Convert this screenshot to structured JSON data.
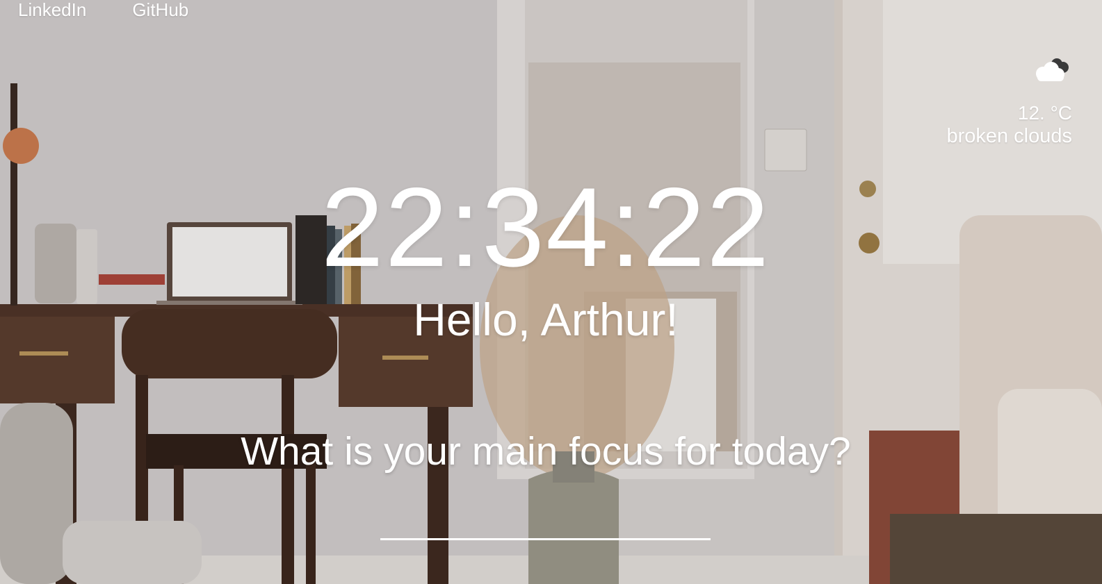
{
  "nav": {
    "links": [
      {
        "label": "LinkedIn"
      },
      {
        "label": "GitHub"
      }
    ]
  },
  "weather": {
    "icon": "broken-clouds-icon",
    "temperature": "12. °C",
    "description": "broken clouds"
  },
  "clock": {
    "time": "22:34:22"
  },
  "greeting": {
    "text": "Hello, Arthur!"
  },
  "focus": {
    "question": "What is your main focus for today?",
    "value": "",
    "placeholder": ""
  },
  "colors": {
    "text": "#ffffff",
    "wall": "#d9d6d4",
    "desk": "#4a3226",
    "door": "#e8e2dc"
  }
}
